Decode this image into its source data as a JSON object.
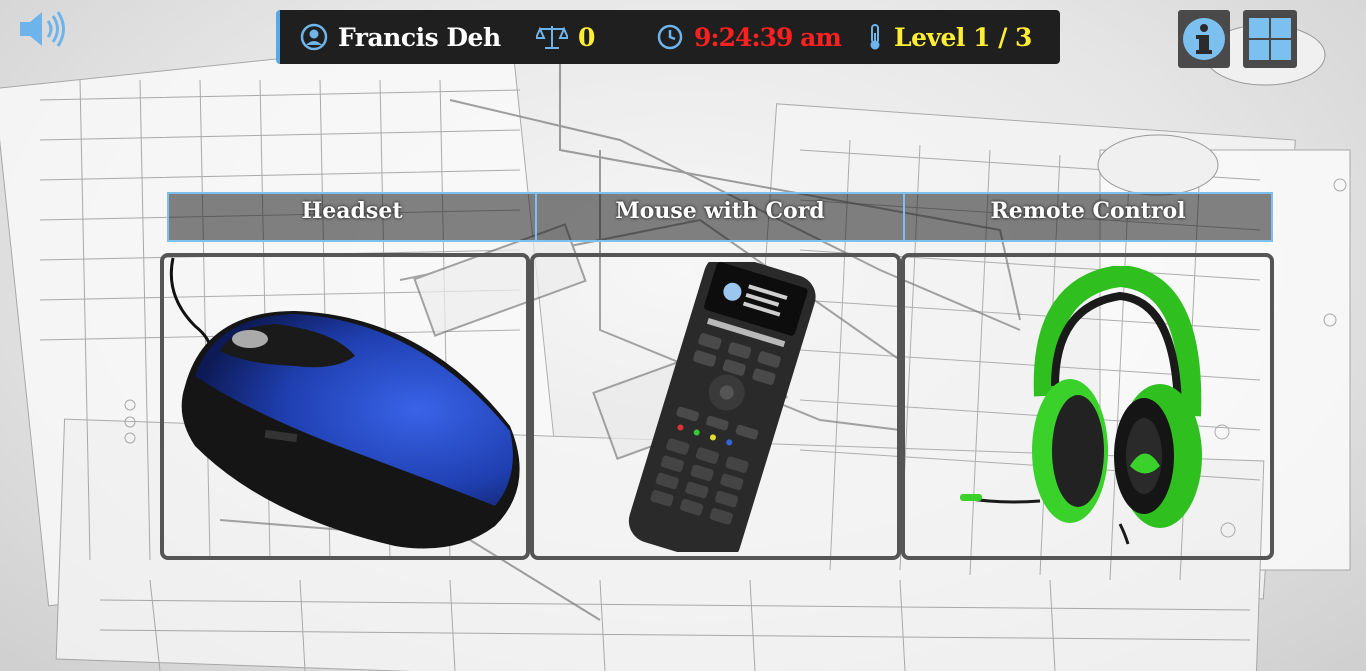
{
  "hud": {
    "player_name": "Francis Deh",
    "score": "0",
    "time": "9:24:39 am",
    "level": "Level 1 / 3"
  },
  "icons": {
    "sound": "speaker-volume-icon",
    "player": "user-circle-icon",
    "score": "balance-scale-icon",
    "time": "clock-icon",
    "level": "thermometer-icon",
    "info": "info-icon",
    "windows": "windows-logo-icon"
  },
  "labels": [
    "Headset",
    "Mouse with Cord",
    "Remote Control"
  ],
  "items": [
    {
      "name": "mouse",
      "color": "#1f3fb0"
    },
    {
      "name": "remote",
      "color": "#2a2a2a"
    },
    {
      "name": "headset",
      "color": "#39d12a"
    }
  ],
  "colors": {
    "accent": "#5aa9e6",
    "score": "#ffee33",
    "time": "#ff2020",
    "hud_bg": "#1f1f1f"
  }
}
